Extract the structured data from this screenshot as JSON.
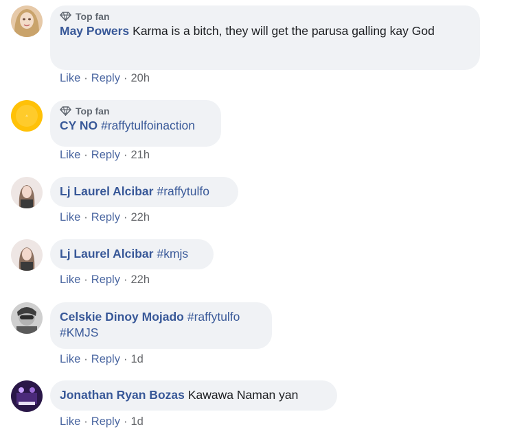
{
  "comments": [
    {
      "badge": "Top fan",
      "author": "May Powers",
      "text": "Karma is a bitch, they will get the parusa galling kay God",
      "hashtags": "",
      "like_label": "Like",
      "reply_label": "Reply",
      "time": "20h"
    },
    {
      "badge": "Top fan",
      "author": "CY NO",
      "text": "",
      "hashtags": "#raffytulfoinaction",
      "like_label": "Like",
      "reply_label": "Reply",
      "time": "21h"
    },
    {
      "badge": "",
      "author": "Lj Laurel Alcibar",
      "text": "",
      "hashtags": "#raffytulfo",
      "like_label": "Like",
      "reply_label": "Reply",
      "time": "22h"
    },
    {
      "badge": "",
      "author": "Lj Laurel Alcibar",
      "text": "",
      "hashtags": "#kmjs",
      "like_label": "Like",
      "reply_label": "Reply",
      "time": "22h"
    },
    {
      "badge": "",
      "author": "Celskie Dinoy Mojado",
      "text": "",
      "hashtags": "#raffytulfo",
      "hashtags_line2": "#KMJS",
      "like_label": "Like",
      "reply_label": "Reply",
      "time": "1d"
    },
    {
      "badge": "",
      "author": "Jonathan Ryan Bozas",
      "text": "Kawawa Naman yan",
      "hashtags": "",
      "like_label": "Like",
      "reply_label": "Reply",
      "time": "1d"
    }
  ],
  "icons": {
    "badge_icon": "diamond-icon"
  },
  "colors": {
    "bubble": "#f0f2f5",
    "author": "#385898",
    "hashtag": "#385898",
    "meta": "#65676b"
  }
}
